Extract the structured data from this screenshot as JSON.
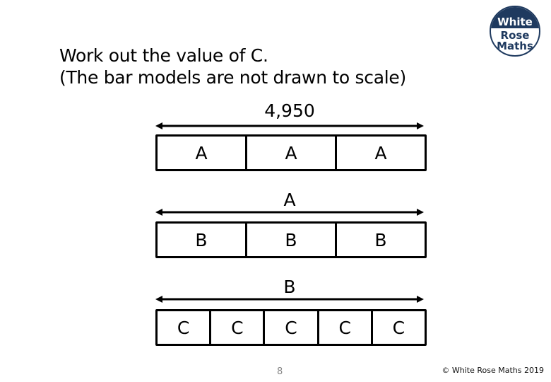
{
  "question": {
    "line1": "Work out the value of C.",
    "line2": "(The bar models are not drawn to scale)"
  },
  "logo": {
    "line1": "White",
    "line2": "Rose",
    "line3": "Maths",
    "color": "#1f3a5f"
  },
  "models": [
    {
      "total_label": "4,950",
      "parts": [
        "A",
        "A",
        "A"
      ]
    },
    {
      "total_label": "A",
      "parts": [
        "B",
        "B",
        "B"
      ]
    },
    {
      "total_label": "B",
      "parts": [
        "C",
        "C",
        "C",
        "C",
        "C"
      ]
    }
  ],
  "footer": {
    "page_number": "8",
    "copyright": "© White Rose Maths 2019"
  }
}
